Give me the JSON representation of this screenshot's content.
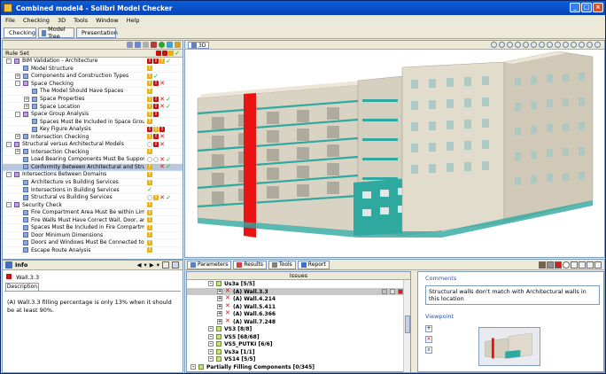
{
  "window": {
    "title": "Combined model4 - Solibri Model Checker",
    "min": "_",
    "max": "□",
    "close": "×"
  },
  "menu": [
    "File",
    "Checking",
    "3D",
    "Tools",
    "Window",
    "Help"
  ],
  "tabs": [
    {
      "label": "Checking"
    },
    {
      "label": "Model Tree"
    },
    {
      "label": "Presentation"
    }
  ],
  "ruleset": {
    "header": "Rule Set",
    "rows": [
      {
        "label": "BIM Validation - Architecture",
        "level": 0,
        "exp": "-",
        "folder": true,
        "marks": [
          "r",
          "r",
          "w",
          "c"
        ]
      },
      {
        "label": "Model Structure",
        "level": 1,
        "exp": "",
        "marks": [
          "w"
        ]
      },
      {
        "label": "Components and Construction Types",
        "level": 1,
        "exp": "+",
        "marks": [
          "w",
          "c"
        ]
      },
      {
        "label": "Space Checking",
        "level": 1,
        "exp": "-",
        "folder": true,
        "marks": [
          "w",
          "r",
          "x"
        ]
      },
      {
        "label": "The Model Should Have Spaces",
        "level": 2,
        "exp": "",
        "marks": [
          "w"
        ]
      },
      {
        "label": "Space Properties",
        "level": 2,
        "exp": "+",
        "marks": [
          "w",
          "r",
          "x",
          "c"
        ]
      },
      {
        "label": "Space Location",
        "level": 2,
        "exp": "+",
        "marks": [
          "w",
          "r",
          "x",
          "c"
        ]
      },
      {
        "label": "Space Group Analysis",
        "level": 1,
        "exp": "-",
        "folder": true,
        "marks": [
          "w",
          "r"
        ]
      },
      {
        "label": "Spaces Must Be Included in Space Groups",
        "level": 2,
        "exp": "",
        "marks": [
          "w"
        ]
      },
      {
        "label": "Key Figure Analysis",
        "level": 2,
        "exp": "",
        "marks": [
          "r",
          "w",
          "r"
        ]
      },
      {
        "label": "Intersection Checking",
        "level": 1,
        "exp": "+",
        "marks": [
          "w",
          "r",
          "x"
        ]
      },
      {
        "label": "Structural versus Architectural Models",
        "level": 0,
        "exp": "-",
        "folder": true,
        "marks": [
          "o",
          "r",
          "x"
        ]
      },
      {
        "label": "Intersection Checking",
        "level": 1,
        "exp": "+",
        "marks": [
          "w"
        ]
      },
      {
        "label": "Load Bearing Components Must Be Supported",
        "level": 1,
        "exp": "",
        "marks": [
          "o",
          "o",
          "x",
          "c"
        ]
      },
      {
        "label": "Conformity Between Architectural and Structural",
        "level": 1,
        "exp": "",
        "marks": [
          "w",
          "o",
          "x",
          "c"
        ],
        "selected": true
      },
      {
        "label": "Intersections Between Domains",
        "level": 0,
        "exp": "-",
        "folder": true,
        "marks": [
          "w"
        ]
      },
      {
        "label": "Architecture vs Building Services",
        "level": 1,
        "exp": "",
        "marks": [
          "w"
        ]
      },
      {
        "label": "Intersections in Building Services",
        "level": 1,
        "exp": "",
        "marks": [
          "c"
        ]
      },
      {
        "label": "Structural vs Building Services",
        "level": 1,
        "exp": "",
        "marks": [
          "o",
          "w",
          "x",
          "c"
        ]
      },
      {
        "label": "Security Check",
        "level": 0,
        "exp": "-",
        "folder": true,
        "marks": [
          "w"
        ]
      },
      {
        "label": "Fire Compartment Area Must Be within Limits",
        "level": 1,
        "exp": "",
        "marks": [
          "w"
        ]
      },
      {
        "label": "Fire Walls Must Have Correct Wall, Door, and Win",
        "level": 1,
        "exp": "",
        "marks": [
          "w"
        ]
      },
      {
        "label": "Spaces Must Be Included in Fire Compartments",
        "level": 1,
        "exp": "",
        "marks": [
          "w"
        ]
      },
      {
        "label": "Door Minimum Dimensions",
        "level": 1,
        "exp": "",
        "marks": [
          "w"
        ]
      },
      {
        "label": "Doors and Windows Must Be Connected to Spaces",
        "level": 1,
        "exp": "",
        "marks": [
          "w"
        ]
      },
      {
        "label": "Escape Route Analysis",
        "level": 1,
        "exp": "",
        "marks": [
          "w"
        ]
      }
    ]
  },
  "info": {
    "title": "Info",
    "item": "Wall.3.3",
    "tab": "Description",
    "text": "(A) Wall.3.3 filling percentage is only 13% when it should be at least 90%."
  },
  "view3d": {
    "label": "3D"
  },
  "bottomtabs": [
    {
      "label": "Parameters"
    },
    {
      "label": "Results"
    },
    {
      "label": "Tools"
    },
    {
      "label": "Report"
    }
  ],
  "issues": {
    "header": "Issues",
    "rows": [
      {
        "label": "Us3a [5/5]",
        "level": 2,
        "icon": "w",
        "selected": false
      },
      {
        "label": "(A) Wall.3.3",
        "level": 3,
        "icon": "x",
        "selected": true
      },
      {
        "label": "(A) Wall.4.214",
        "level": 3,
        "icon": "x"
      },
      {
        "label": "(A) Wall.5.411",
        "level": 3,
        "icon": "x"
      },
      {
        "label": "(A) Wall.6.366",
        "level": 3,
        "icon": "x"
      },
      {
        "label": "(A) Wall.7.248",
        "level": 3,
        "icon": "x"
      },
      {
        "label": "VS3 [8/8]",
        "level": 2,
        "icon": "w"
      },
      {
        "label": "VS5 [68/68]",
        "level": 2,
        "icon": "w"
      },
      {
        "label": "VS5_PUTKI [6/6]",
        "level": 2,
        "icon": "w"
      },
      {
        "label": "Vs3a [1/1]",
        "level": 2,
        "icon": "w"
      },
      {
        "label": "VS14 [5/5]",
        "level": 2,
        "icon": "w"
      },
      {
        "label": "Partially Filling Components [0/345]",
        "level": 0,
        "icon": "w"
      }
    ]
  },
  "comments": {
    "label": "Comments",
    "text": "Structural walls don't match with Architectural walls in this location"
  },
  "viewpoint": {
    "label": "Viewpoint"
  }
}
